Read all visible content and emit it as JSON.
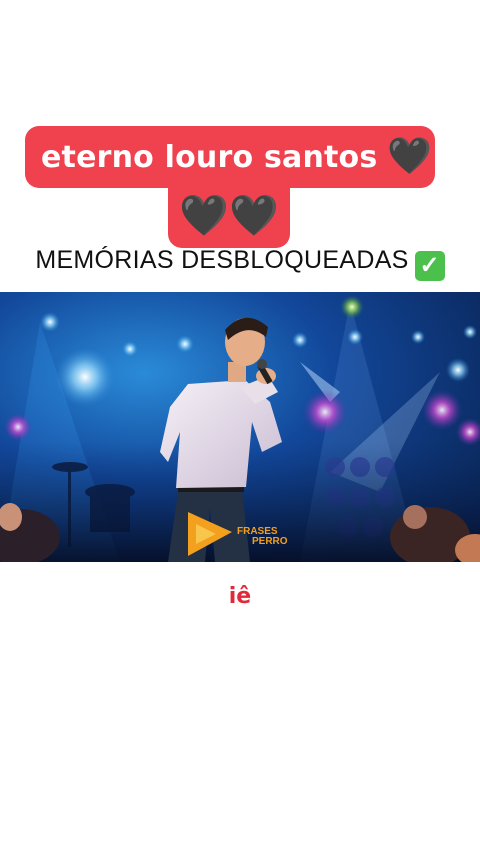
{
  "caption": {
    "line1": "eterno louro santos",
    "line1_emoji": "🖤",
    "line2_emoji": "🖤🖤",
    "bg_color": "#f0414f"
  },
  "subtitle": {
    "text": "MEMÓRIAS DESBLOQUEADAS",
    "check_icon": "✓"
  },
  "video": {
    "watermark_text": "FRASES PERRO",
    "watermark_icon": "play-triangle-logo"
  },
  "footer": {
    "text": "iê",
    "color": "#e02a3a"
  }
}
